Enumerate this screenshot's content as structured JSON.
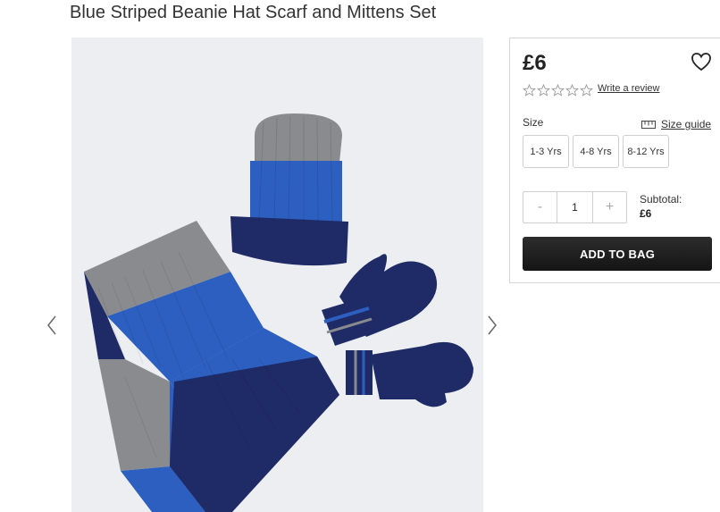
{
  "product": {
    "title": "Blue Striped Beanie Hat Scarf and Mittens Set",
    "price": "£6"
  },
  "reviews": {
    "rating": 0,
    "max_stars": 5,
    "write_review_label": "Write a review"
  },
  "size": {
    "label": "Size",
    "guide_label": "Size guide",
    "options": [
      "1-3 Yrs",
      "4-8 Yrs",
      "8-12 Yrs"
    ]
  },
  "quantity": {
    "decrement_label": "-",
    "increment_label": "+",
    "value": "1"
  },
  "subtotal": {
    "label": "Subtotal:",
    "value": "£6"
  },
  "cart": {
    "add_label": "ADD TO BAG"
  },
  "icons": {
    "favorite": "heart-icon",
    "star": "star-outline-icon",
    "size_guide": "ruler-icon",
    "prev": "chevron-left-icon",
    "next": "chevron-right-icon"
  },
  "colors": {
    "button_bg": "#1c1c1c",
    "royal_blue": "#2c5fbf",
    "navy": "#1f2b66",
    "grey": "#8e8e90"
  }
}
